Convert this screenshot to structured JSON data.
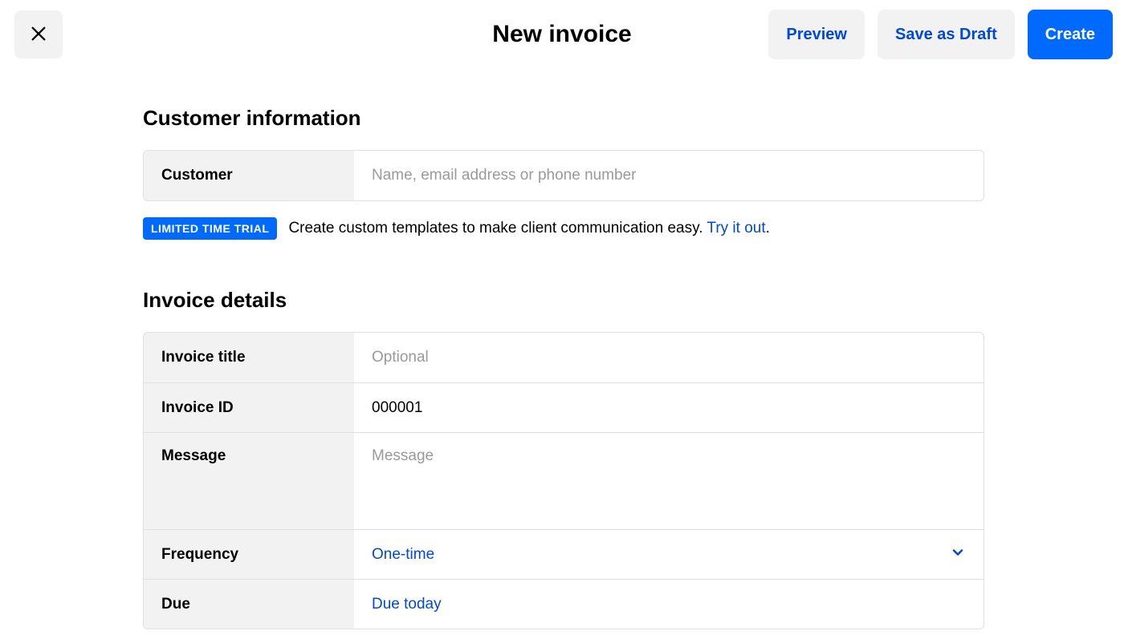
{
  "header": {
    "title": "New invoice",
    "preview_label": "Preview",
    "save_draft_label": "Save as Draft",
    "create_label": "Create"
  },
  "sections": {
    "customer_info_title": "Customer information",
    "invoice_details_title": "Invoice details"
  },
  "fields": {
    "customer": {
      "label": "Customer",
      "placeholder": "Name, email address or phone number",
      "value": ""
    },
    "invoice_title": {
      "label": "Invoice title",
      "placeholder": "Optional",
      "value": ""
    },
    "invoice_id": {
      "label": "Invoice ID",
      "value": "000001"
    },
    "message": {
      "label": "Message",
      "placeholder": "Message",
      "value": ""
    },
    "frequency": {
      "label": "Frequency",
      "value": "One-time"
    },
    "due": {
      "label": "Due",
      "value": "Due today"
    }
  },
  "promo": {
    "badge": "LIMITED TIME TRIAL",
    "text": "Create custom templates to make client communication easy. ",
    "link_text": "Try it out",
    "suffix": "."
  }
}
